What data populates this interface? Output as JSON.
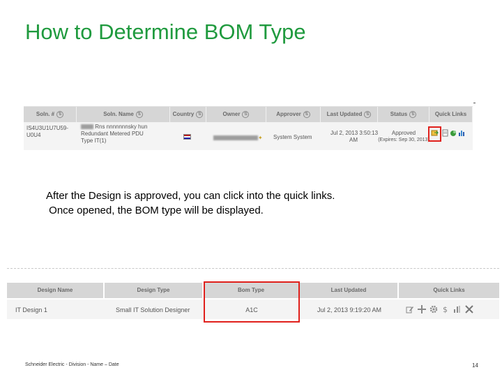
{
  "slide": {
    "title": "How to Determine BOM Type",
    "note_line1": "After the Design is approved, you can click into the quick links.",
    "note_line2": " Once opened, the BOM type will be displayed.",
    "footer": "Schneider Electric - Division - Name – Date",
    "page_number": "14"
  },
  "solutions_table": {
    "headers": [
      "Soln. #",
      "Soln. Name",
      "Country",
      "Owner",
      "Approver",
      "Last Updated",
      "Status",
      "Quick Links"
    ],
    "row": {
      "soln_number_line1": "IS4U3U1U7U59-",
      "soln_number_line2": "U0U4",
      "soln_name_line1": "Rns nnnnnnnsky hun",
      "soln_name_line2": "Redundant Metered PDU",
      "soln_name_line3": "Type IT(1)",
      "approver": "System System",
      "last_updated_line1": "Jul 2, 2013 3:50:13",
      "last_updated_line2": "AM",
      "status_line1": "Approved",
      "status_line2": "(Expires: Sep 30, 2013)"
    },
    "quick_link_icons": [
      "bom-details-icon",
      "document-icon",
      "copy-icon",
      "chart-icon"
    ]
  },
  "design_table": {
    "headers": [
      "Design Name",
      "Design Type",
      "Bom Type",
      "Last Updated",
      "Quick Links"
    ],
    "row": {
      "design_name": "IT Design 1",
      "design_type": "Small IT Solution Designer",
      "bom_type": "A1C",
      "last_updated": "Jul 2, 2013 9:19:20 AM"
    },
    "quick_link_icons": [
      "edit-icon",
      "move-icon",
      "gear-icon",
      "dollar-icon",
      "chart-icon",
      "delete-icon"
    ]
  },
  "colors": {
    "title_green": "#1f9a3e",
    "highlight_red": "#e0201c",
    "header_gray": "#d6d6d6"
  }
}
